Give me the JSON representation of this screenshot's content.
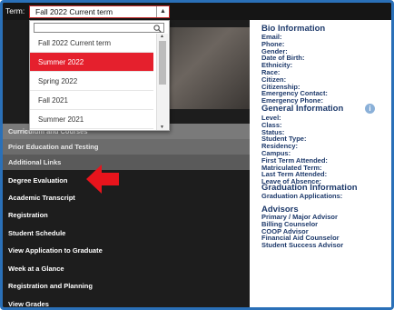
{
  "term_bar": {
    "label": "Term:",
    "selected_term": "Fall 2022 Current term",
    "arrow": "▲"
  },
  "dropdown": {
    "search_placeholder": "",
    "options": [
      {
        "label": "Fall 2022 Current term",
        "selected": false
      },
      {
        "label": "Summer 2022",
        "selected": true
      },
      {
        "label": "Spring 2022",
        "selected": false
      },
      {
        "label": "Fall 2021",
        "selected": false
      },
      {
        "label": "Summer 2021",
        "selected": false
      }
    ],
    "selected_color": "#e5202d"
  },
  "nav": {
    "sections": [
      "Curriculum and Courses",
      "Prior Education and Testing",
      "Additional Links"
    ],
    "items": [
      "Degree Evaluation",
      "Academic Transcript",
      "Registration",
      "Student Schedule",
      "View Application to Graduate",
      "Week at a Glance",
      "Registration and Planning",
      "View Grades"
    ]
  },
  "annotation": {
    "arrow_color": "#e8141c"
  },
  "info": {
    "bio": {
      "title": "Bio Information",
      "fields": [
        "Email:",
        "Phone:",
        "Gender:",
        "Date of Birth:",
        "Ethnicity:",
        "Race:",
        "Citizen:",
        "Citizenship:",
        "Emergency Contact:",
        "Emergency Phone:"
      ]
    },
    "general": {
      "title": "General Information",
      "fields": [
        "Level:",
        "Class:",
        "Status:",
        "Student Type:",
        "Residency:",
        "Campus:",
        "First Term Attended:",
        "Matriculated Term:",
        "Last Term Attended:",
        "Leave of Absence:"
      ]
    },
    "graduation": {
      "title": "Graduation Information",
      "fields": [
        "Graduation Applications:"
      ]
    },
    "advisors": {
      "title": "Advisors",
      "fields": [
        "Primary / Major Advisor",
        "Billing Counselor",
        "COOP Advisor",
        "Financial Aid Counselor",
        "Student Success Advisor"
      ]
    }
  }
}
